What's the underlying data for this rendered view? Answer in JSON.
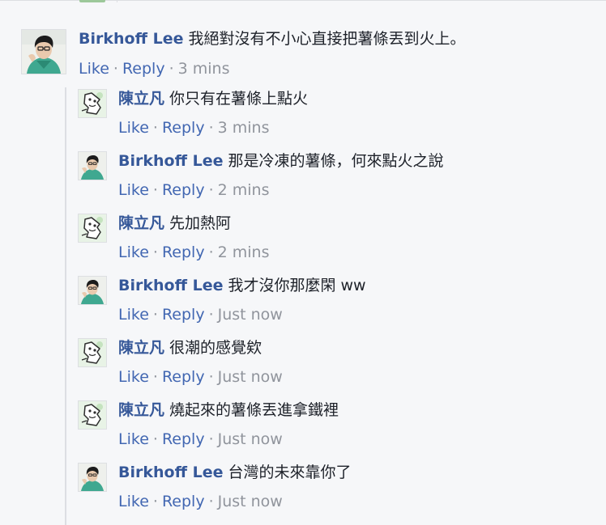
{
  "actions": {
    "like": "Like",
    "reply": "Reply",
    "separator": "·"
  },
  "main_comment": {
    "author": "Birkhoff Lee",
    "text": "我絕對沒有不小心直接把薯條丟到火上。",
    "time": "3 mins",
    "avatar_icon": "boy-avatar-icon"
  },
  "replies": [
    {
      "author": "陳立凡",
      "text": "你只有在薯條上點火",
      "time": "3 mins",
      "avatar_icon": "cartoon-avatar-icon"
    },
    {
      "author": "Birkhoff Lee",
      "text": "那是冷凍的薯條，何來點火之說",
      "time": "2 mins",
      "avatar_icon": "boy-avatar-icon"
    },
    {
      "author": "陳立凡",
      "text": "先加熱阿",
      "time": "2 mins",
      "avatar_icon": "cartoon-avatar-icon"
    },
    {
      "author": "Birkhoff Lee",
      "text": "我才沒你那麼閑 ww",
      "time": "Just now",
      "avatar_icon": "boy-avatar-icon"
    },
    {
      "author": "陳立凡",
      "text": "很潮的感覺欸",
      "time": "Just now",
      "avatar_icon": "cartoon-avatar-icon"
    },
    {
      "author": "陳立凡",
      "text": "燒起來的薯條丟進拿鐵裡",
      "time": "Just now",
      "avatar_icon": "cartoon-avatar-icon"
    },
    {
      "author": "Birkhoff Lee",
      "text": "台灣的未來靠你了",
      "time": "Just now",
      "avatar_icon": "boy-avatar-icon"
    }
  ],
  "colors": {
    "background": "#f6f7f9",
    "author_link": "#365899",
    "action_link": "#4267b2",
    "meta_text": "#90949c",
    "body_text": "#1d2129",
    "thread_line": "#dcdee3"
  }
}
